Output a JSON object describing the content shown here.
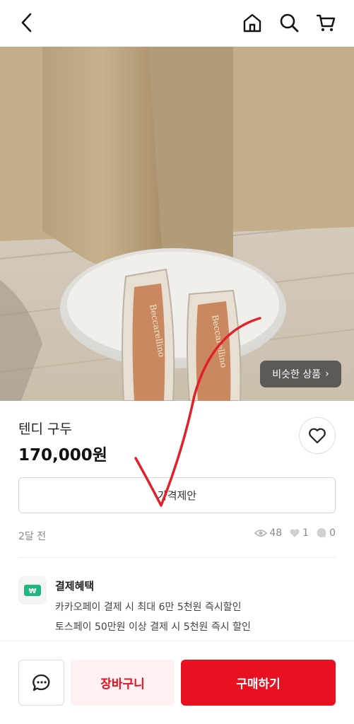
{
  "nav": {
    "back_icon": "back-arrow-icon",
    "home_icon": "home-icon",
    "search_icon": "search-icon",
    "cart_icon": "cart-icon"
  },
  "image": {
    "similar_label": "비슷한 상품",
    "insole_text_left": "Beccarellino",
    "insole_text_right": "Beccarellino"
  },
  "product": {
    "name": "텐디 구두",
    "price": "170,000원",
    "offer_label": "가격제안",
    "posted_ago": "2달 전",
    "views": "48",
    "likes": "1",
    "comments": "0"
  },
  "benefit": {
    "title": "결제혜택",
    "line1": "카카오페이 결제 시 최대 6만 5천원 즉시할인",
    "line2": "토스페이 50만원 이상 결제 시 5천원 즉시 할인"
  },
  "bottom": {
    "cart_label": "장바구니",
    "buy_label": "구매하기"
  },
  "colors": {
    "accent": "#e8111f",
    "accent_soft": "#fff0f2",
    "annotation": "#e0202a"
  }
}
